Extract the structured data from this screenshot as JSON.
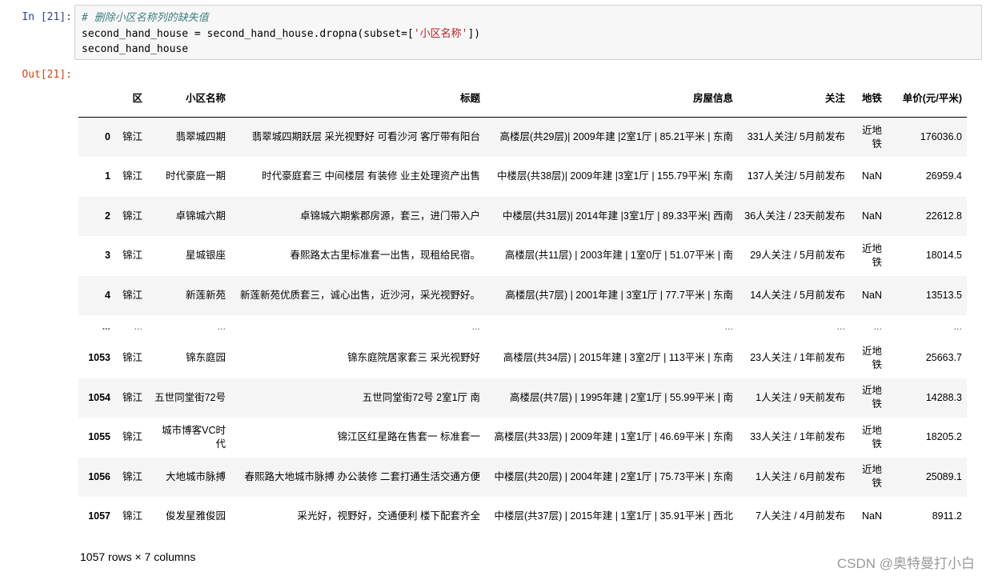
{
  "input_prompt": "In  [21]:",
  "output_prompt": "Out[21]:",
  "code": {
    "comment": "# 删除小区名称列的缺失值",
    "line2_pre": "second_hand_house = second_hand_house.dropna(subset=[",
    "line2_str": "'小区名称'",
    "line2_post": "])",
    "line3": "second_hand_house"
  },
  "table": {
    "columns": [
      "",
      "区",
      "小区名称",
      "标题",
      "房屋信息",
      "关注",
      "地铁",
      "单价(元/平米)"
    ],
    "rows": [
      {
        "index": "0",
        "cells": [
          "锦江",
          "翡翠城四期",
          "翡翠城四期跃层 采光视野好 可看沙河 客厅带有阳台",
          "高楼层(共29层)| 2009年建 |2室1厅 | 85.21平米 | 东南",
          "331人关注/ 5月前发布",
          "近地铁",
          "176036.0"
        ]
      },
      {
        "index": "1",
        "cells": [
          "锦江",
          "时代豪庭一期",
          "时代豪庭套三 中间楼层 有装修 业主处理资产出售",
          "中楼层(共38层)| 2009年建 |3室1厅 | 155.79平米| 东南",
          "137人关注/ 5月前发布",
          "NaN",
          "26959.4"
        ]
      },
      {
        "index": "2",
        "cells": [
          "锦江",
          "卓锦城六期",
          "卓锦城六期紫郡房源，套三，进门带入户",
          "中楼层(共31层)| 2014年建 |3室1厅 | 89.33平米| 西南",
          "36人关注 / 23天前发布",
          "NaN",
          "22612.8"
        ]
      },
      {
        "index": "3",
        "cells": [
          "锦江",
          "星城银座",
          "春熙路太古里标准套一出售，现租给民宿。",
          "高楼层(共11层) | 2003年建 | 1室0厅 | 51.07平米 | 南",
          "29人关注 / 5月前发布",
          "近地铁",
          "18014.5"
        ]
      },
      {
        "index": "4",
        "cells": [
          "锦江",
          "新莲新苑",
          "新莲新苑优质套三，诚心出售，近沙河，采光视野好。",
          "高楼层(共7层) | 2001年建 | 3室1厅 | 77.7平米 | 东南",
          "14人关注 / 5月前发布",
          "NaN",
          "13513.5"
        ]
      },
      {
        "index": "...",
        "cells": [
          "...",
          "...",
          "...",
          "...",
          "...",
          "...",
          "..."
        ],
        "ellipsis": true
      },
      {
        "index": "1053",
        "cells": [
          "锦江",
          "锦东庭园",
          "锦东庭院居家套三 采光视野好",
          "高楼层(共34层) | 2015年建 | 3室2厅 | 113平米 | 东南",
          "23人关注 / 1年前发布",
          "近地铁",
          "25663.7"
        ]
      },
      {
        "index": "1054",
        "cells": [
          "锦江",
          "五世同堂街72号",
          "五世同堂街72号 2室1厅 南",
          "高楼层(共7层) | 1995年建 | 2室1厅 | 55.99平米 | 南",
          "1人关注 / 9天前发布",
          "近地铁",
          "14288.3"
        ]
      },
      {
        "index": "1055",
        "cells": [
          "锦江",
          "城市博客VC时代",
          "锦江区红星路在售套一 标准套一",
          "高楼层(共33层) | 2009年建 | 1室1厅 | 46.69平米 | 东南",
          "33人关注 / 1年前发布",
          "近地铁",
          "18205.2"
        ]
      },
      {
        "index": "1056",
        "cells": [
          "锦江",
          "大地城市脉搏",
          "春熙路大地城市脉搏 办公装修 二套打通生活交通方便",
          "中楼层(共20层) | 2004年建 | 2室1厅 | 75.73平米 | 东南",
          "1人关注 / 6月前发布",
          "近地铁",
          "25089.1"
        ]
      },
      {
        "index": "1057",
        "cells": [
          "锦江",
          "俊发星雅俊园",
          "采光好，视野好，交通便利 楼下配套齐全",
          "中楼层(共37层) | 2015年建 | 1室1厅 | 35.91平米 | 西北",
          "7人关注 / 4月前发布",
          "NaN",
          "8911.2"
        ]
      }
    ]
  },
  "shape_note": "1057 rows × 7 columns",
  "watermark": "CSDN @奥特曼打小白"
}
